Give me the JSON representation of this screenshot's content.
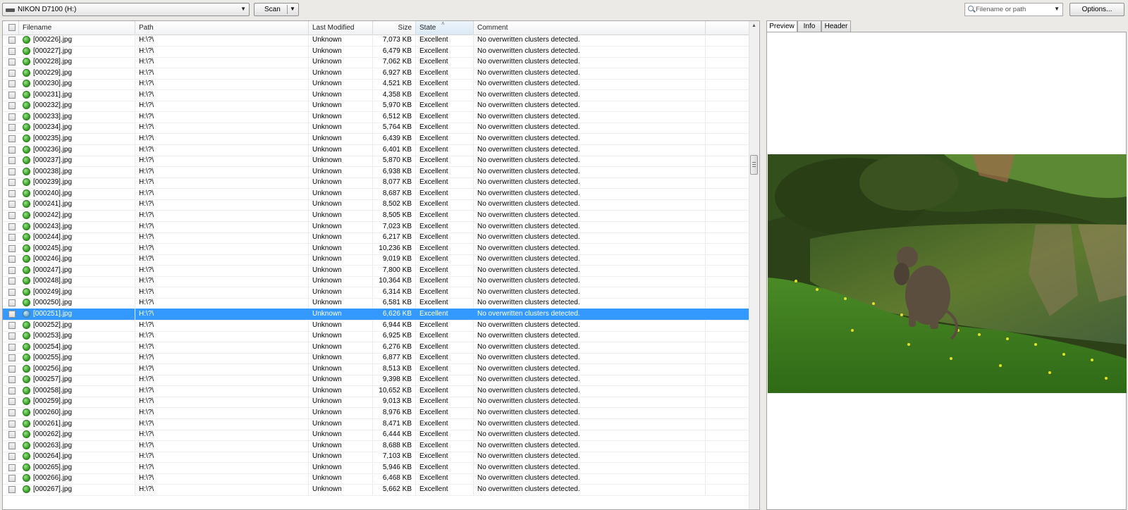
{
  "toolbar": {
    "drive_label": "NIKON D7100 (H:)",
    "scan_label": "Scan",
    "search_placeholder": "Filename or path",
    "options_label": "Options..."
  },
  "table": {
    "columns": [
      "Filename",
      "Path",
      "Last Modified",
      "Size",
      "State",
      "Comment"
    ],
    "sorted_column": "State",
    "selected_index": 25,
    "rows": [
      {
        "filename": "[000226].jpg",
        "path": "H:\\?\\",
        "modified": "Unknown",
        "size": "7,073 KB",
        "state": "Excellent",
        "comment": "No overwritten clusters detected."
      },
      {
        "filename": "[000227].jpg",
        "path": "H:\\?\\",
        "modified": "Unknown",
        "size": "6,479 KB",
        "state": "Excellent",
        "comment": "No overwritten clusters detected."
      },
      {
        "filename": "[000228].jpg",
        "path": "H:\\?\\",
        "modified": "Unknown",
        "size": "7,062 KB",
        "state": "Excellent",
        "comment": "No overwritten clusters detected."
      },
      {
        "filename": "[000229].jpg",
        "path": "H:\\?\\",
        "modified": "Unknown",
        "size": "6,927 KB",
        "state": "Excellent",
        "comment": "No overwritten clusters detected."
      },
      {
        "filename": "[000230].jpg",
        "path": "H:\\?\\",
        "modified": "Unknown",
        "size": "4,521 KB",
        "state": "Excellent",
        "comment": "No overwritten clusters detected."
      },
      {
        "filename": "[000231].jpg",
        "path": "H:\\?\\",
        "modified": "Unknown",
        "size": "4,358 KB",
        "state": "Excellent",
        "comment": "No overwritten clusters detected."
      },
      {
        "filename": "[000232].jpg",
        "path": "H:\\?\\",
        "modified": "Unknown",
        "size": "5,970 KB",
        "state": "Excellent",
        "comment": "No overwritten clusters detected."
      },
      {
        "filename": "[000233].jpg",
        "path": "H:\\?\\",
        "modified": "Unknown",
        "size": "6,512 KB",
        "state": "Excellent",
        "comment": "No overwritten clusters detected."
      },
      {
        "filename": "[000234].jpg",
        "path": "H:\\?\\",
        "modified": "Unknown",
        "size": "5,764 KB",
        "state": "Excellent",
        "comment": "No overwritten clusters detected."
      },
      {
        "filename": "[000235].jpg",
        "path": "H:\\?\\",
        "modified": "Unknown",
        "size": "6,439 KB",
        "state": "Excellent",
        "comment": "No overwritten clusters detected."
      },
      {
        "filename": "[000236].jpg",
        "path": "H:\\?\\",
        "modified": "Unknown",
        "size": "6,401 KB",
        "state": "Excellent",
        "comment": "No overwritten clusters detected."
      },
      {
        "filename": "[000237].jpg",
        "path": "H:\\?\\",
        "modified": "Unknown",
        "size": "5,870 KB",
        "state": "Excellent",
        "comment": "No overwritten clusters detected."
      },
      {
        "filename": "[000238].jpg",
        "path": "H:\\?\\",
        "modified": "Unknown",
        "size": "6,938 KB",
        "state": "Excellent",
        "comment": "No overwritten clusters detected."
      },
      {
        "filename": "[000239].jpg",
        "path": "H:\\?\\",
        "modified": "Unknown",
        "size": "8,077 KB",
        "state": "Excellent",
        "comment": "No overwritten clusters detected."
      },
      {
        "filename": "[000240].jpg",
        "path": "H:\\?\\",
        "modified": "Unknown",
        "size": "8,687 KB",
        "state": "Excellent",
        "comment": "No overwritten clusters detected."
      },
      {
        "filename": "[000241].jpg",
        "path": "H:\\?\\",
        "modified": "Unknown",
        "size": "8,502 KB",
        "state": "Excellent",
        "comment": "No overwritten clusters detected."
      },
      {
        "filename": "[000242].jpg",
        "path": "H:\\?\\",
        "modified": "Unknown",
        "size": "8,505 KB",
        "state": "Excellent",
        "comment": "No overwritten clusters detected."
      },
      {
        "filename": "[000243].jpg",
        "path": "H:\\?\\",
        "modified": "Unknown",
        "size": "7,023 KB",
        "state": "Excellent",
        "comment": "No overwritten clusters detected."
      },
      {
        "filename": "[000244].jpg",
        "path": "H:\\?\\",
        "modified": "Unknown",
        "size": "6,217 KB",
        "state": "Excellent",
        "comment": "No overwritten clusters detected."
      },
      {
        "filename": "[000245].jpg",
        "path": "H:\\?\\",
        "modified": "Unknown",
        "size": "10,236 KB",
        "state": "Excellent",
        "comment": "No overwritten clusters detected."
      },
      {
        "filename": "[000246].jpg",
        "path": "H:\\?\\",
        "modified": "Unknown",
        "size": "9,019 KB",
        "state": "Excellent",
        "comment": "No overwritten clusters detected."
      },
      {
        "filename": "[000247].jpg",
        "path": "H:\\?\\",
        "modified": "Unknown",
        "size": "7,800 KB",
        "state": "Excellent",
        "comment": "No overwritten clusters detected."
      },
      {
        "filename": "[000248].jpg",
        "path": "H:\\?\\",
        "modified": "Unknown",
        "size": "10,364 KB",
        "state": "Excellent",
        "comment": "No overwritten clusters detected."
      },
      {
        "filename": "[000249].jpg",
        "path": "H:\\?\\",
        "modified": "Unknown",
        "size": "6,314 KB",
        "state": "Excellent",
        "comment": "No overwritten clusters detected."
      },
      {
        "filename": "[000250].jpg",
        "path": "H:\\?\\",
        "modified": "Unknown",
        "size": "6,581 KB",
        "state": "Excellent",
        "comment": "No overwritten clusters detected."
      },
      {
        "filename": "[000251].jpg",
        "path": "H:\\?\\",
        "modified": "Unknown",
        "size": "6,626 KB",
        "state": "Excellent",
        "comment": "No overwritten clusters detected."
      },
      {
        "filename": "[000252].jpg",
        "path": "H:\\?\\",
        "modified": "Unknown",
        "size": "6,944 KB",
        "state": "Excellent",
        "comment": "No overwritten clusters detected."
      },
      {
        "filename": "[000253].jpg",
        "path": "H:\\?\\",
        "modified": "Unknown",
        "size": "6,925 KB",
        "state": "Excellent",
        "comment": "No overwritten clusters detected."
      },
      {
        "filename": "[000254].jpg",
        "path": "H:\\?\\",
        "modified": "Unknown",
        "size": "6,276 KB",
        "state": "Excellent",
        "comment": "No overwritten clusters detected."
      },
      {
        "filename": "[000255].jpg",
        "path": "H:\\?\\",
        "modified": "Unknown",
        "size": "6,877 KB",
        "state": "Excellent",
        "comment": "No overwritten clusters detected."
      },
      {
        "filename": "[000256].jpg",
        "path": "H:\\?\\",
        "modified": "Unknown",
        "size": "8,513 KB",
        "state": "Excellent",
        "comment": "No overwritten clusters detected."
      },
      {
        "filename": "[000257].jpg",
        "path": "H:\\?\\",
        "modified": "Unknown",
        "size": "9,398 KB",
        "state": "Excellent",
        "comment": "No overwritten clusters detected."
      },
      {
        "filename": "[000258].jpg",
        "path": "H:\\?\\",
        "modified": "Unknown",
        "size": "10,652 KB",
        "state": "Excellent",
        "comment": "No overwritten clusters detected."
      },
      {
        "filename": "[000259].jpg",
        "path": "H:\\?\\",
        "modified": "Unknown",
        "size": "9,013 KB",
        "state": "Excellent",
        "comment": "No overwritten clusters detected."
      },
      {
        "filename": "[000260].jpg",
        "path": "H:\\?\\",
        "modified": "Unknown",
        "size": "8,976 KB",
        "state": "Excellent",
        "comment": "No overwritten clusters detected."
      },
      {
        "filename": "[000261].jpg",
        "path": "H:\\?\\",
        "modified": "Unknown",
        "size": "8,471 KB",
        "state": "Excellent",
        "comment": "No overwritten clusters detected."
      },
      {
        "filename": "[000262].jpg",
        "path": "H:\\?\\",
        "modified": "Unknown",
        "size": "6,444 KB",
        "state": "Excellent",
        "comment": "No overwritten clusters detected."
      },
      {
        "filename": "[000263].jpg",
        "path": "H:\\?\\",
        "modified": "Unknown",
        "size": "8,688 KB",
        "state": "Excellent",
        "comment": "No overwritten clusters detected."
      },
      {
        "filename": "[000264].jpg",
        "path": "H:\\?\\",
        "modified": "Unknown",
        "size": "7,103 KB",
        "state": "Excellent",
        "comment": "No overwritten clusters detected."
      },
      {
        "filename": "[000265].jpg",
        "path": "H:\\?\\",
        "modified": "Unknown",
        "size": "5,946 KB",
        "state": "Excellent",
        "comment": "No overwritten clusters detected."
      },
      {
        "filename": "[000266].jpg",
        "path": "H:\\?\\",
        "modified": "Unknown",
        "size": "6,468 KB",
        "state": "Excellent",
        "comment": "No overwritten clusters detected."
      },
      {
        "filename": "[000267].jpg",
        "path": "H:\\?\\",
        "modified": "Unknown",
        "size": "5,662 KB",
        "state": "Excellent",
        "comment": "No overwritten clusters detected."
      }
    ]
  },
  "preview": {
    "tabs": [
      "Preview",
      "Info",
      "Header"
    ],
    "active_tab": "Preview"
  },
  "colors": {
    "selection": "#3399ff",
    "status_ok": "#3aa62a",
    "window_bg": "#eceae6"
  },
  "icons": {
    "drive": "drive-icon",
    "status": "status-ok-icon",
    "search": "search-icon"
  }
}
